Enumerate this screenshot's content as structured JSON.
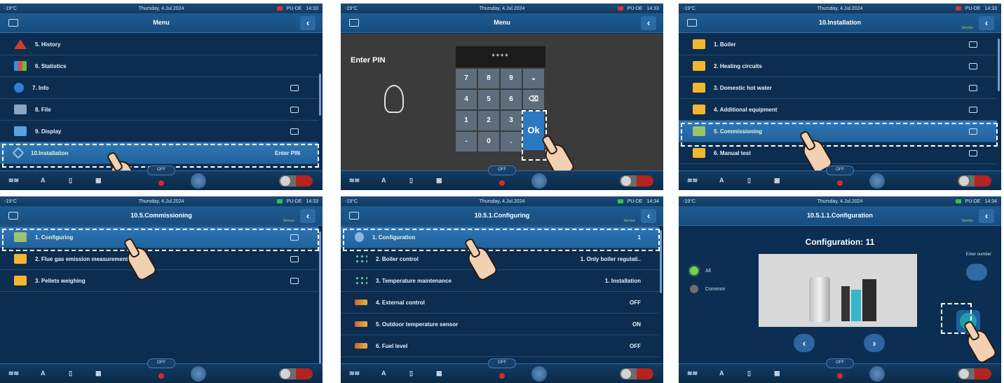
{
  "common": {
    "temperature": "-19°C",
    "date": "Thursday, 4.Jul.2024",
    "locale": "PU-DE",
    "off_label": "OFF",
    "service_label": "Service"
  },
  "panels": [
    {
      "title": "Menu",
      "time": "14:33",
      "rows": [
        {
          "label": "5. History",
          "icon": "warning-icon",
          "value": ""
        },
        {
          "label": "6. Statistics",
          "icon": "statistics-icon",
          "value": ""
        },
        {
          "label": "7. Info",
          "icon": "info-icon",
          "value": ""
        },
        {
          "label": "8. File",
          "icon": "file-icon",
          "value": ""
        },
        {
          "label": "9. Display",
          "icon": "display-icon",
          "value": ""
        },
        {
          "label": "10.Installation",
          "icon": "tools-icon",
          "value": "Enter PIN"
        }
      ]
    },
    {
      "title": "Menu",
      "time": "14:33",
      "pin_prompt": "Enter PIN",
      "pin_value": "****",
      "keys": [
        "7",
        "8",
        "9",
        "4",
        "5",
        "6",
        "1",
        "2",
        "3",
        "-",
        "0",
        "."
      ],
      "ok_label": "Ok"
    },
    {
      "title": "10.Installation",
      "time": "14:33",
      "rows": [
        {
          "label": "1. Boiler"
        },
        {
          "label": "2. Heating circuits"
        },
        {
          "label": "3. Domestic hot water"
        },
        {
          "label": "4. Additional equipment"
        },
        {
          "label": "5. Commissioning"
        },
        {
          "label": "6. Manual test"
        }
      ]
    },
    {
      "title": "10.5.Commissioning",
      "time": "14:33",
      "rows": [
        {
          "label": "1. Configuring"
        },
        {
          "label": "2. Flue gas emission measurement"
        },
        {
          "label": "3. Pellets weighing"
        }
      ]
    },
    {
      "title": "10.5.1.Configuring",
      "time": "14:34",
      "rows": [
        {
          "label": "1. Configuration",
          "value": "1"
        },
        {
          "label": "2. Boiler control",
          "value": "1. Only boiler regulati.."
        },
        {
          "label": "3. Temperature maintenance",
          "value": "1. Installation"
        },
        {
          "label": "4. External control",
          "value": "OFF"
        },
        {
          "label": "5. Outdoor temperature sensor",
          "value": "ON"
        },
        {
          "label": "6. Fuel level",
          "value": "OFF"
        }
      ]
    },
    {
      "title": "10.5.1.1.Configuration",
      "time": "14:34",
      "heading": "Configuration: 11",
      "radio_all": "All",
      "radio_common": "Common",
      "enter_number": "Enter number"
    }
  ]
}
